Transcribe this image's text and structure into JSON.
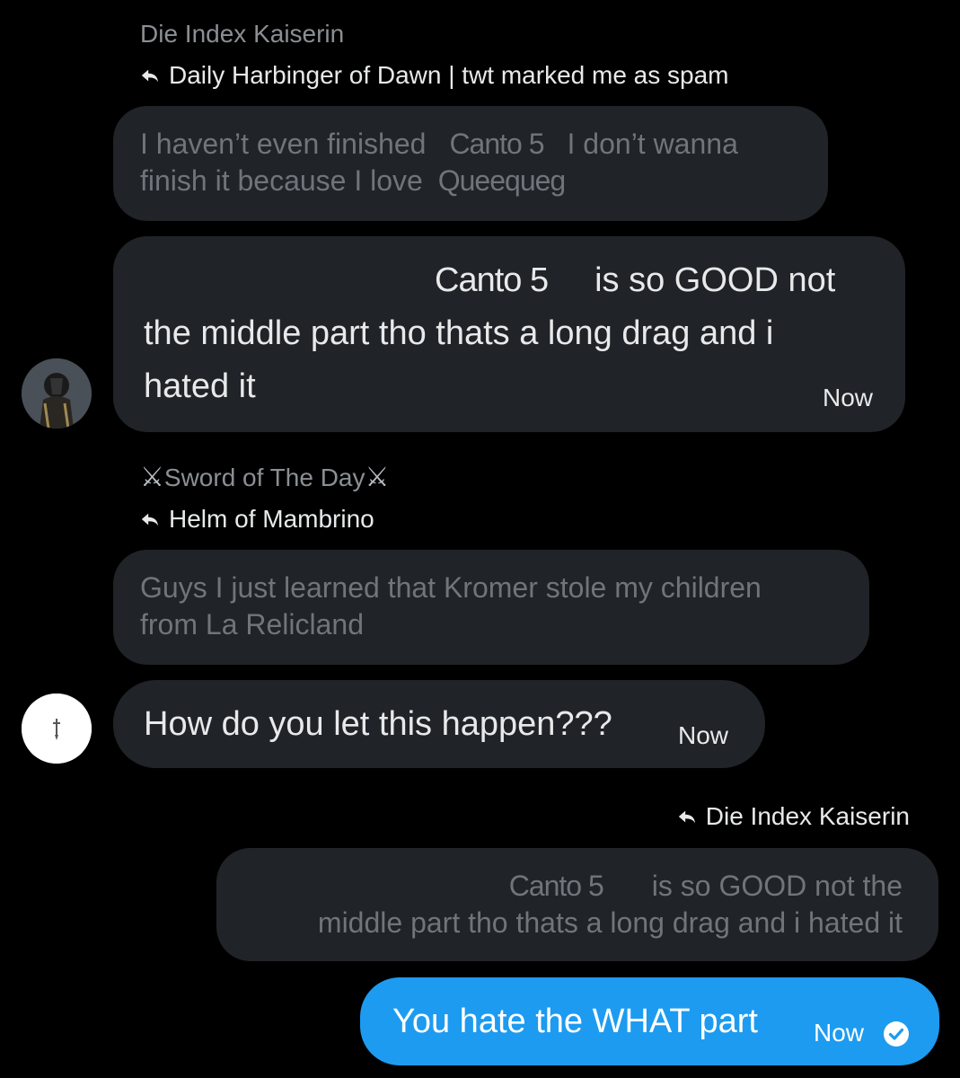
{
  "colors": {
    "background": "#000000",
    "bubble_incoming": "#202327",
    "bubble_outgoing": "#1d9bf0",
    "quoted_text": "#6f757b",
    "sender_name": "#8b8f94"
  },
  "group1": {
    "sender": "Die Index Kaiserin",
    "reply_to": "Daily Harbinger of Dawn | twt marked me as spam",
    "quoted": {
      "line1_a": "I haven’t even finished",
      "canto": "Canto 5",
      "line1_b": "I don’t wanna",
      "line2_a": "finish it because I love",
      "queequeg": "Queequeg"
    },
    "message": {
      "canto": "Canto 5",
      "line1": "is so GOOD not",
      "line2": "the middle part tho thats a long drag and i",
      "line3": "hated it",
      "time": "Now"
    },
    "avatar_icon": "armored-knight-avatar"
  },
  "group2": {
    "sender_sword_left": "⚔",
    "sender": "Sword of The Day",
    "sender_sword_right": "⚔",
    "reply_to": "Helm of Mambrino",
    "quoted": {
      "line1": "Guys I just learned that Kromer stole my children",
      "line2": "from La Relicland"
    },
    "message": {
      "text": "How do you let this happen???",
      "time": "Now"
    },
    "avatar_icon": "dagger-avatar"
  },
  "group3": {
    "reply_to": "Die Index Kaiserin",
    "quoted": {
      "canto": "Canto 5",
      "line1": "is so GOOD not the",
      "line2": "middle part tho thats a long drag and i hated it"
    },
    "message": {
      "text": "You hate the WHAT part",
      "time": "Now",
      "status_icon": "read-check-icon"
    }
  }
}
